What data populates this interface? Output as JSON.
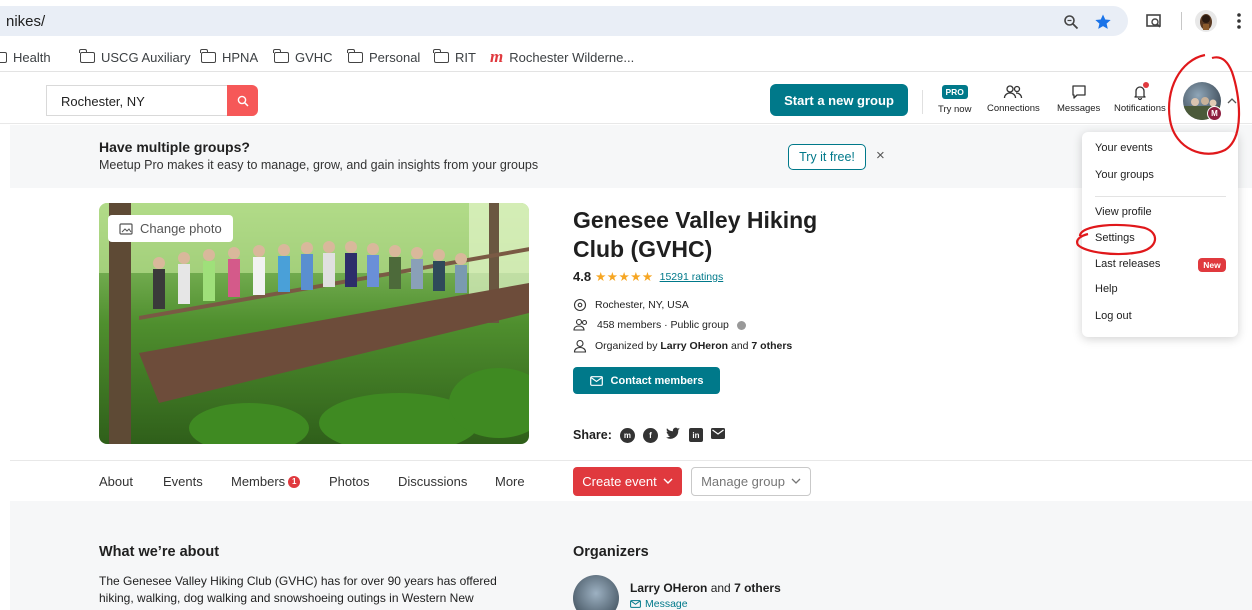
{
  "browser": {
    "url": "nikes/",
    "colors": {
      "omnibox": "#e9eef6",
      "star": "#1a73e8"
    }
  },
  "bookmarks": [
    {
      "label": "Health",
      "icon": "folder-icon"
    },
    {
      "label": "USCG Auxiliary",
      "icon": "folder-icon"
    },
    {
      "label": "HPNA",
      "icon": "folder-icon"
    },
    {
      "label": "GVHC",
      "icon": "folder-icon"
    },
    {
      "label": "Personal",
      "icon": "folder-icon"
    },
    {
      "label": "RIT",
      "icon": "folder-icon"
    },
    {
      "label": "Rochester Wilderne...",
      "icon": "meetup-logo-icon"
    }
  ],
  "header": {
    "location_value": "Rochester, NY",
    "start_group": "Start a new group",
    "pro_badge": "PRO",
    "nav": {
      "try_now": "Try now",
      "connections": "Connections",
      "messages": "Messages",
      "notifications": "Notifications"
    },
    "avatar_badge": "M"
  },
  "pro_banner": {
    "title": "Have multiple groups?",
    "subtitle": "Meetup Pro makes it easy to manage, grow, and gain insights from your groups",
    "cta": "Try it free!",
    "close": "×"
  },
  "group": {
    "change_photo": "Change photo",
    "title": "Genesee Valley Hiking Club (GVHC)",
    "rating_value": "4.8",
    "stars_rating": 4.8,
    "stars": "★★★★★",
    "ratings_count": "15291 ratings",
    "location": "Rochester, NY, USA",
    "members_text": "458 members · Public group",
    "organized_prefix": "Organized by ",
    "organizer": "Larry OHeron",
    "organized_mid": " and ",
    "others": "7 others",
    "contact_btn": "Contact members",
    "share_label": "Share:"
  },
  "tabs": [
    {
      "label": "About"
    },
    {
      "label": "Events"
    },
    {
      "label": "Members",
      "badge": "1"
    },
    {
      "label": "Photos"
    },
    {
      "label": "Discussions"
    },
    {
      "label": "More"
    }
  ],
  "actions": {
    "create_event": "Create event",
    "manage_group": "Manage group"
  },
  "about": {
    "heading": "What we’re about",
    "text": "The Genesee Valley Hiking Club (GVHC) has for over 90 years has offered hiking, walking, dog walking and snowshoeing outings in Western New"
  },
  "organizers": {
    "heading": "Organizers",
    "name": "Larry OHeron",
    "and": " and ",
    "others": "7 others",
    "message": "Message"
  },
  "dropdown": {
    "items": [
      "Your events",
      "Your groups",
      "View profile",
      "Settings",
      "Last releases",
      "Help",
      "Log out"
    ],
    "new_badge": "New"
  },
  "colors": {
    "teal": "#00798a",
    "red": "#e0393e",
    "coral": "#f65858",
    "annotation_red": "#e0181b"
  }
}
